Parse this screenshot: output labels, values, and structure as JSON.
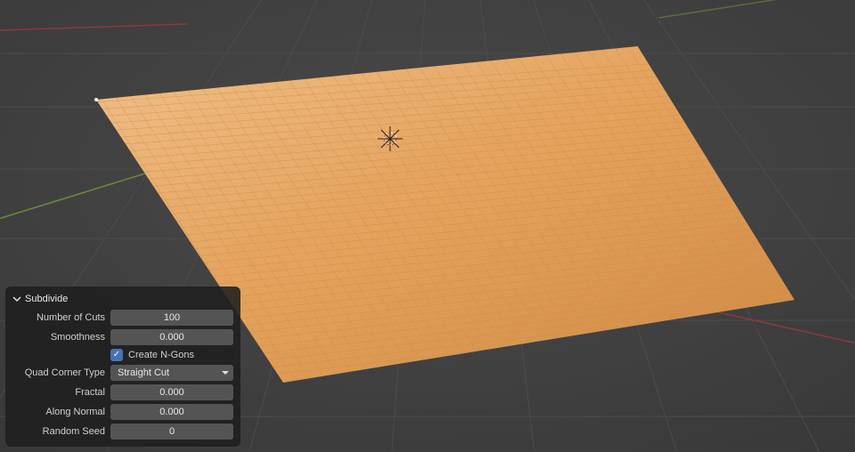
{
  "panel": {
    "title": "Subdivide",
    "number_of_cuts": {
      "label": "Number of Cuts",
      "value": "100"
    },
    "smoothness": {
      "label": "Smoothness",
      "value": "0.000"
    },
    "create_ngons": {
      "label": "Create N-Gons",
      "checked": true
    },
    "quad_corner_type": {
      "label": "Quad Corner Type",
      "value": "Straight Cut"
    },
    "fractal": {
      "label": "Fractal",
      "value": "0.000"
    },
    "along_normal": {
      "label": "Along Normal",
      "value": "0.000"
    },
    "random_seed": {
      "label": "Random Seed",
      "value": "0"
    }
  },
  "viewport": {
    "axis_x_color": "#8b2e2e",
    "axis_y_color": "#5b7d2e",
    "grid_color": "#4c4c4c",
    "mesh_fill": "#e4a35e",
    "mesh_wire": "#d58b3f"
  }
}
